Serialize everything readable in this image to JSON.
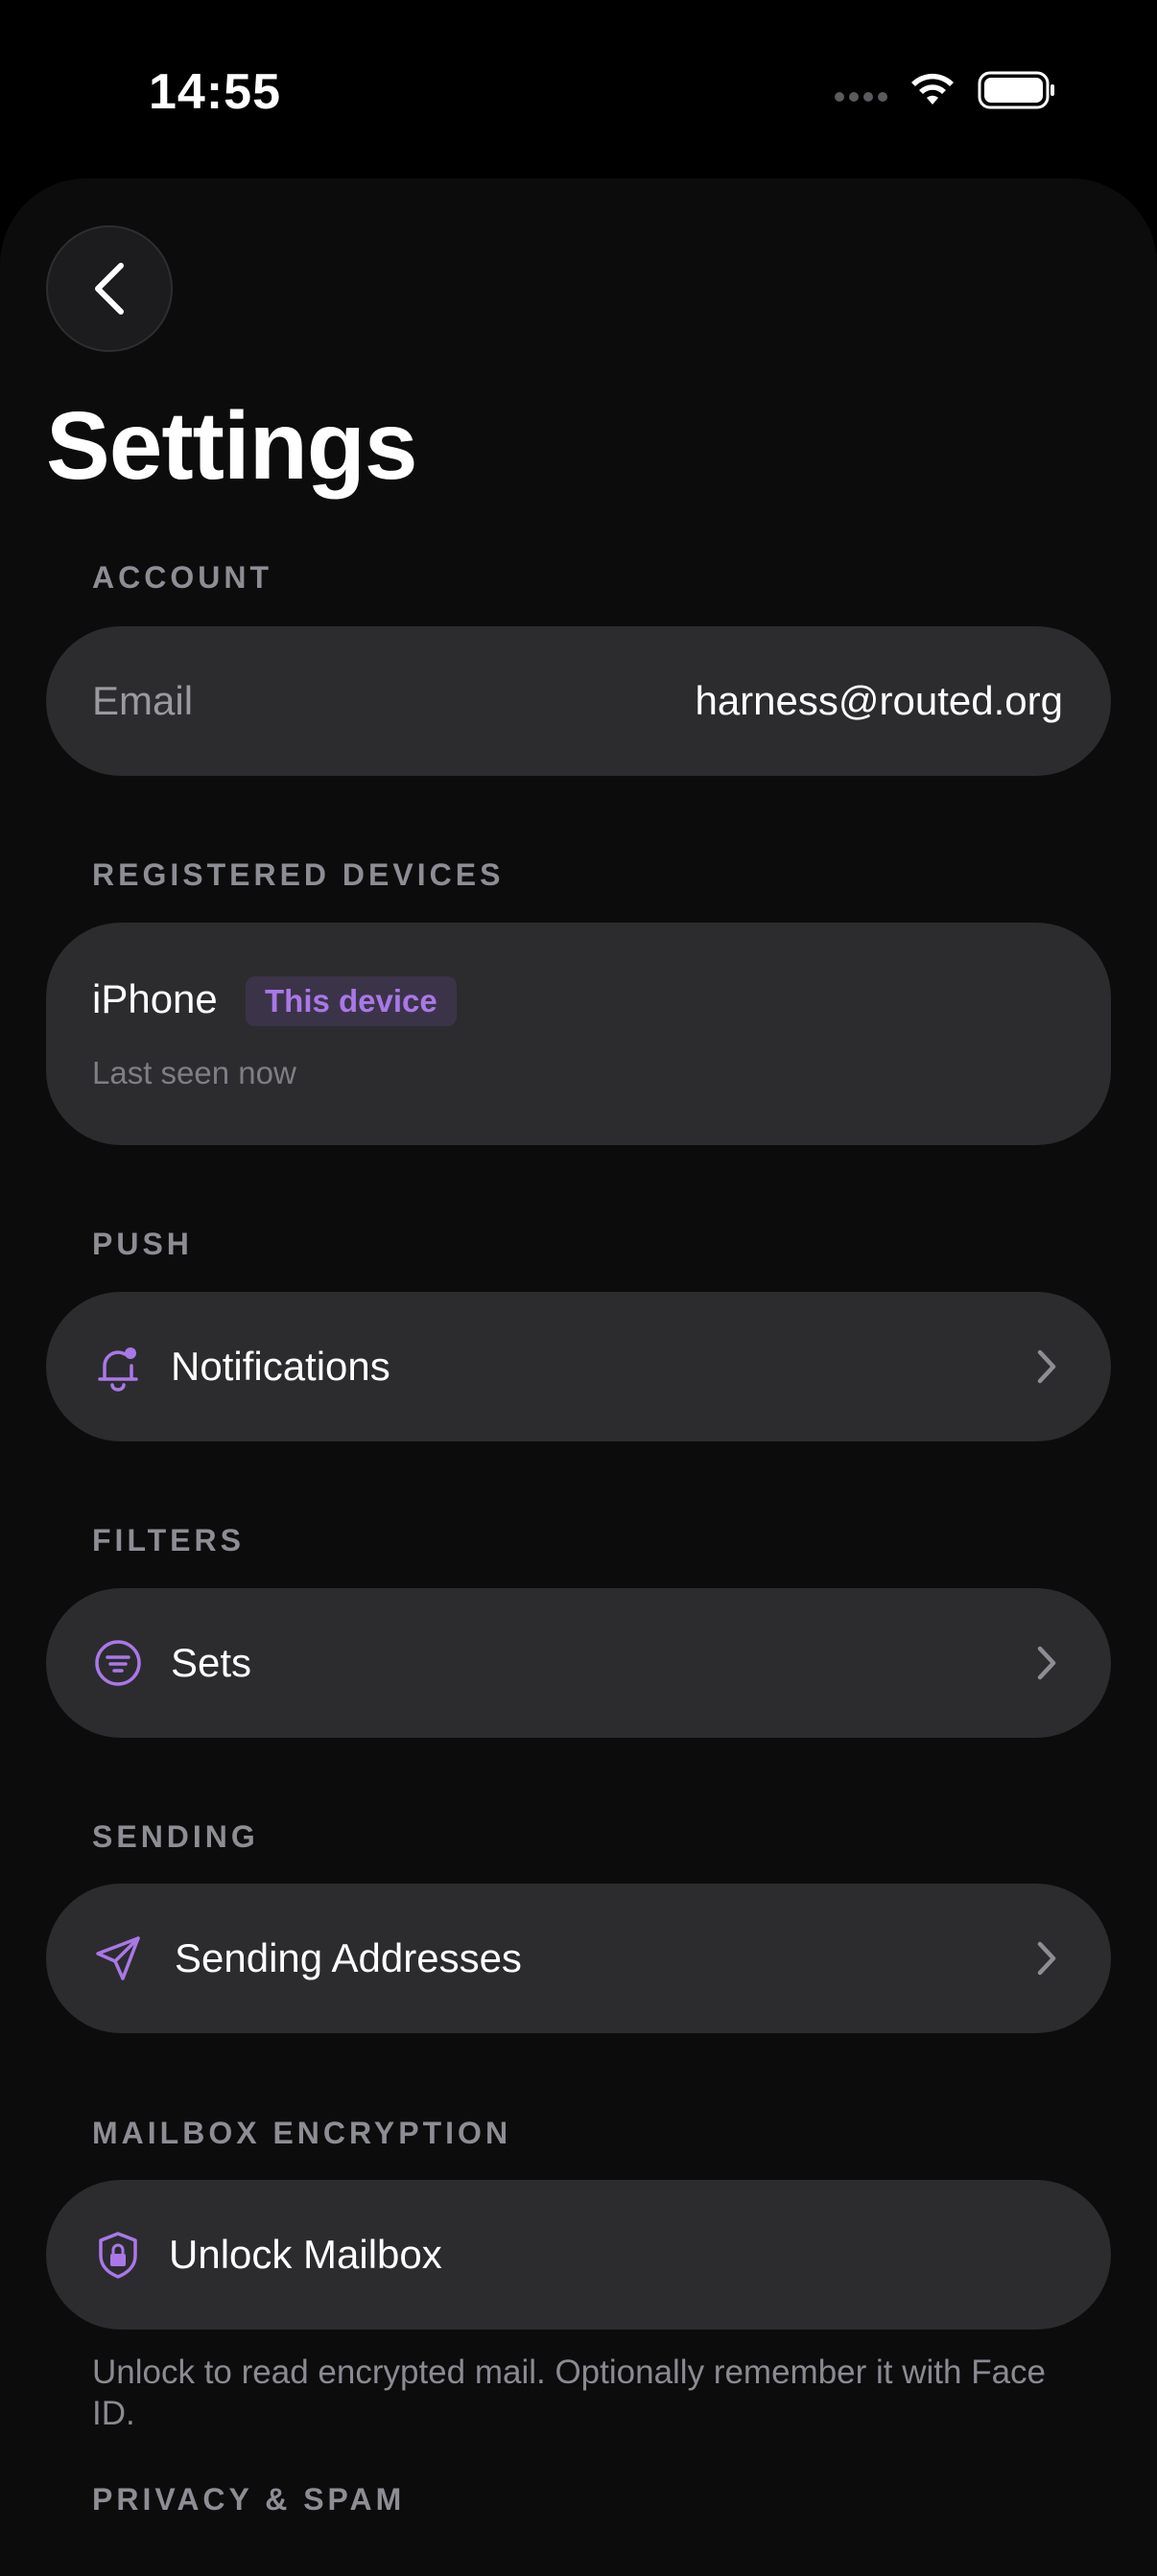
{
  "status_bar": {
    "time": "14:55"
  },
  "header": {
    "title": "Settings"
  },
  "sections": {
    "account": {
      "label": "ACCOUNT",
      "email_label": "Email",
      "email_value": "harness@routed.org"
    },
    "devices": {
      "label": "REGISTERED DEVICES",
      "device_name": "iPhone",
      "badge": "This device",
      "last_seen": "Last seen now"
    },
    "push": {
      "label": "PUSH",
      "item": "Notifications"
    },
    "filters": {
      "label": "FILTERS",
      "item": "Sets"
    },
    "sending": {
      "label": "SENDING",
      "item": "Sending Addresses"
    },
    "encryption": {
      "label": "MAILBOX ENCRYPTION",
      "item": "Unlock Mailbox",
      "helper": "Unlock to read encrypted mail. Optionally remember it with Face ID."
    },
    "privacy": {
      "label": "PRIVACY & SPAM"
    }
  },
  "colors": {
    "accent": "#a978e8",
    "card": "#2c2c2e",
    "background": "#0c0c0d"
  }
}
